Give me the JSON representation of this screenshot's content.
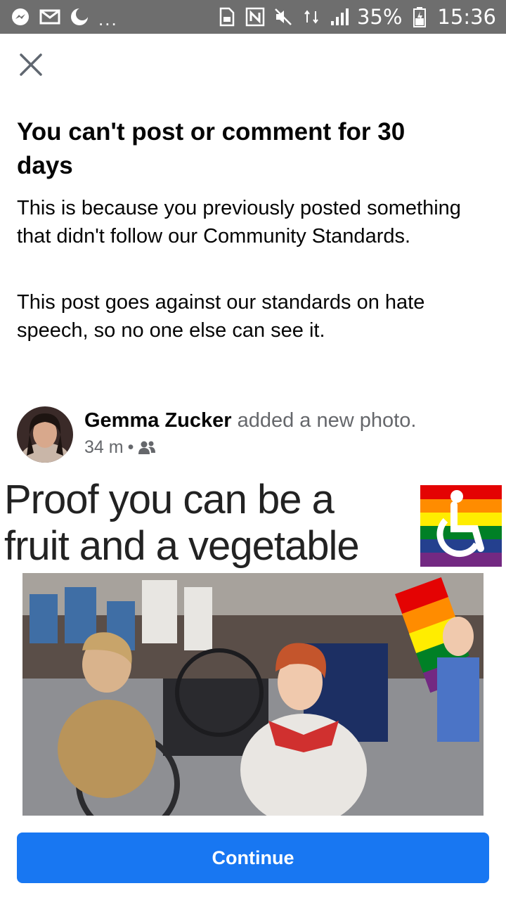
{
  "status_bar": {
    "battery": "35%",
    "time": "15:36",
    "dots": "..."
  },
  "dialog": {
    "title": "You can't post or comment for 30 days",
    "paragraph1": "This is because you previously posted something that didn't follow our Community Standards.",
    "paragraph2": "This post goes against our standards on hate speech, so no one else can see it."
  },
  "post": {
    "author": "Gemma Zucker",
    "action": " added a new photo.",
    "time": "34 m",
    "separator": "•",
    "audience_icon": "friends-icon",
    "photo_caption_line1": "Proof you can be a",
    "photo_caption_line2": "fruit and a vegetable"
  },
  "footer": {
    "continue_label": "Continue"
  },
  "colors": {
    "accent": "#1877f2",
    "status_bar": "#6e6e6e",
    "secondary_text": "#65676b"
  }
}
